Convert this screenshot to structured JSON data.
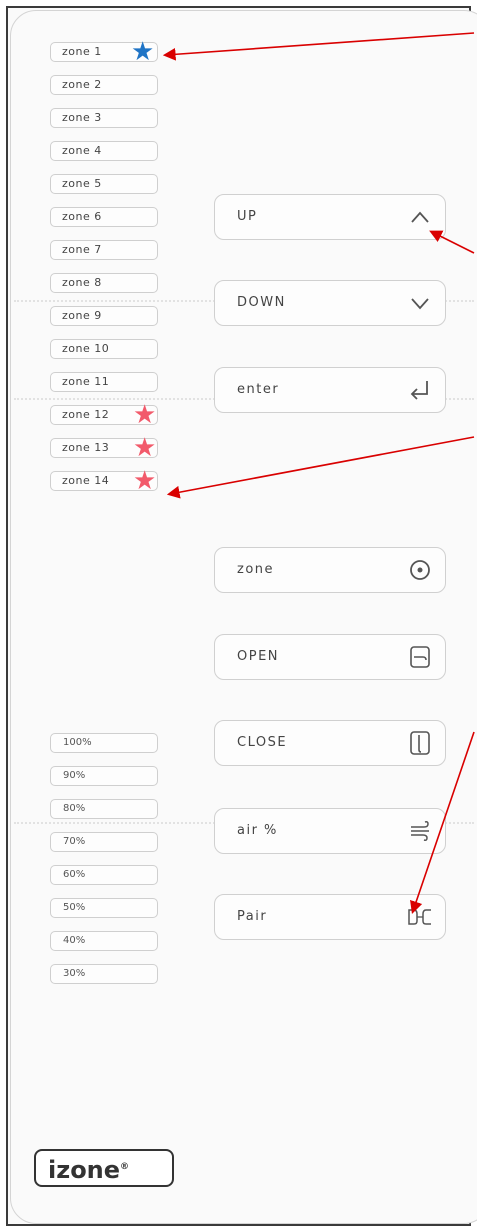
{
  "zones": [
    {
      "label": "zone 1",
      "star": "blue"
    },
    {
      "label": "zone 2",
      "star": ""
    },
    {
      "label": "zone 3",
      "star": ""
    },
    {
      "label": "zone 4",
      "star": ""
    },
    {
      "label": "zone 5",
      "star": ""
    },
    {
      "label": "zone 6",
      "star": ""
    },
    {
      "label": "zone 7",
      "star": ""
    },
    {
      "label": "zone 8",
      "star": ""
    },
    {
      "label": "zone 9",
      "star": ""
    },
    {
      "label": "zone 10",
      "star": ""
    },
    {
      "label": "zone 11",
      "star": ""
    },
    {
      "label": "zone 12",
      "star": "red"
    },
    {
      "label": "zone 13",
      "star": "red"
    },
    {
      "label": "zone 14",
      "star": "red"
    }
  ],
  "percentages": [
    "100%",
    "90%",
    "80%",
    "70%",
    "60%",
    "50%",
    "40%",
    "30%"
  ],
  "controls": {
    "up": {
      "label": "UP",
      "icon": "chevron-up-icon"
    },
    "down": {
      "label": "DOWN",
      "icon": "chevron-down-icon"
    },
    "enter": {
      "label": "enter",
      "icon": "enter-return-icon"
    },
    "zone": {
      "label": "zone",
      "icon": "target-circle-icon"
    },
    "open": {
      "label": "OPEN",
      "icon": "damper-open-icon"
    },
    "close": {
      "label": "CLOSE",
      "icon": "damper-close-icon"
    },
    "air": {
      "label": "air %",
      "icon": "airflow-icon"
    },
    "pair": {
      "label": "Pair",
      "icon": "pair-icon"
    }
  },
  "logo": {
    "text": "izone",
    "mark": "®"
  },
  "colors": {
    "star_blue": "#1f74c6",
    "star_red": "#f25a6b",
    "arrow": "#d90000",
    "border": "#d0d0d0"
  }
}
